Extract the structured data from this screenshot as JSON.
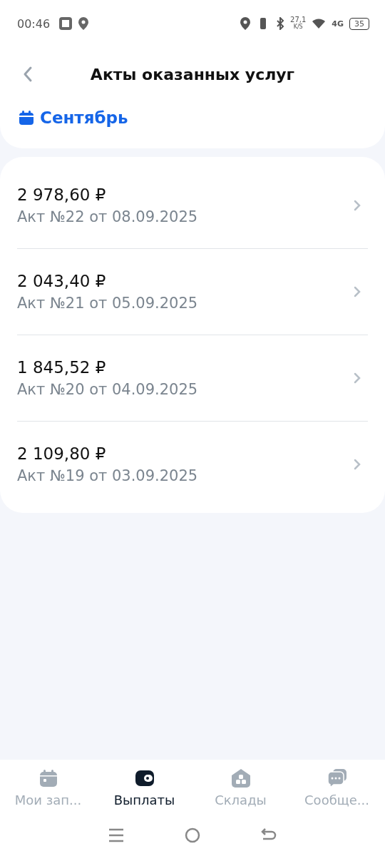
{
  "status_bar": {
    "time": "00:46",
    "speed": "27,1",
    "speed_unit": "K/S",
    "network": "4G",
    "battery": "35"
  },
  "header": {
    "title": "Акты оказанных услуг",
    "month": "Сентябрь"
  },
  "acts": [
    {
      "amount": "2 978,60 ₽",
      "title": "Акт №22 от 08.09.2025"
    },
    {
      "amount": "2 043,40 ₽",
      "title": "Акт №21 от 05.09.2025"
    },
    {
      "amount": "1 845,52 ₽",
      "title": "Акт №20 от 04.09.2025"
    },
    {
      "amount": "2 109,80 ₽",
      "title": "Акт №19 от 03.09.2025"
    }
  ],
  "bottom_nav": [
    {
      "kind": "calendar",
      "label": "Мои зап...",
      "selected": false
    },
    {
      "kind": "wallet",
      "label": "Выплаты",
      "selected": true
    },
    {
      "kind": "warehouse",
      "label": "Склады",
      "selected": false
    },
    {
      "kind": "chat",
      "label": "Сообще...",
      "selected": false
    }
  ]
}
